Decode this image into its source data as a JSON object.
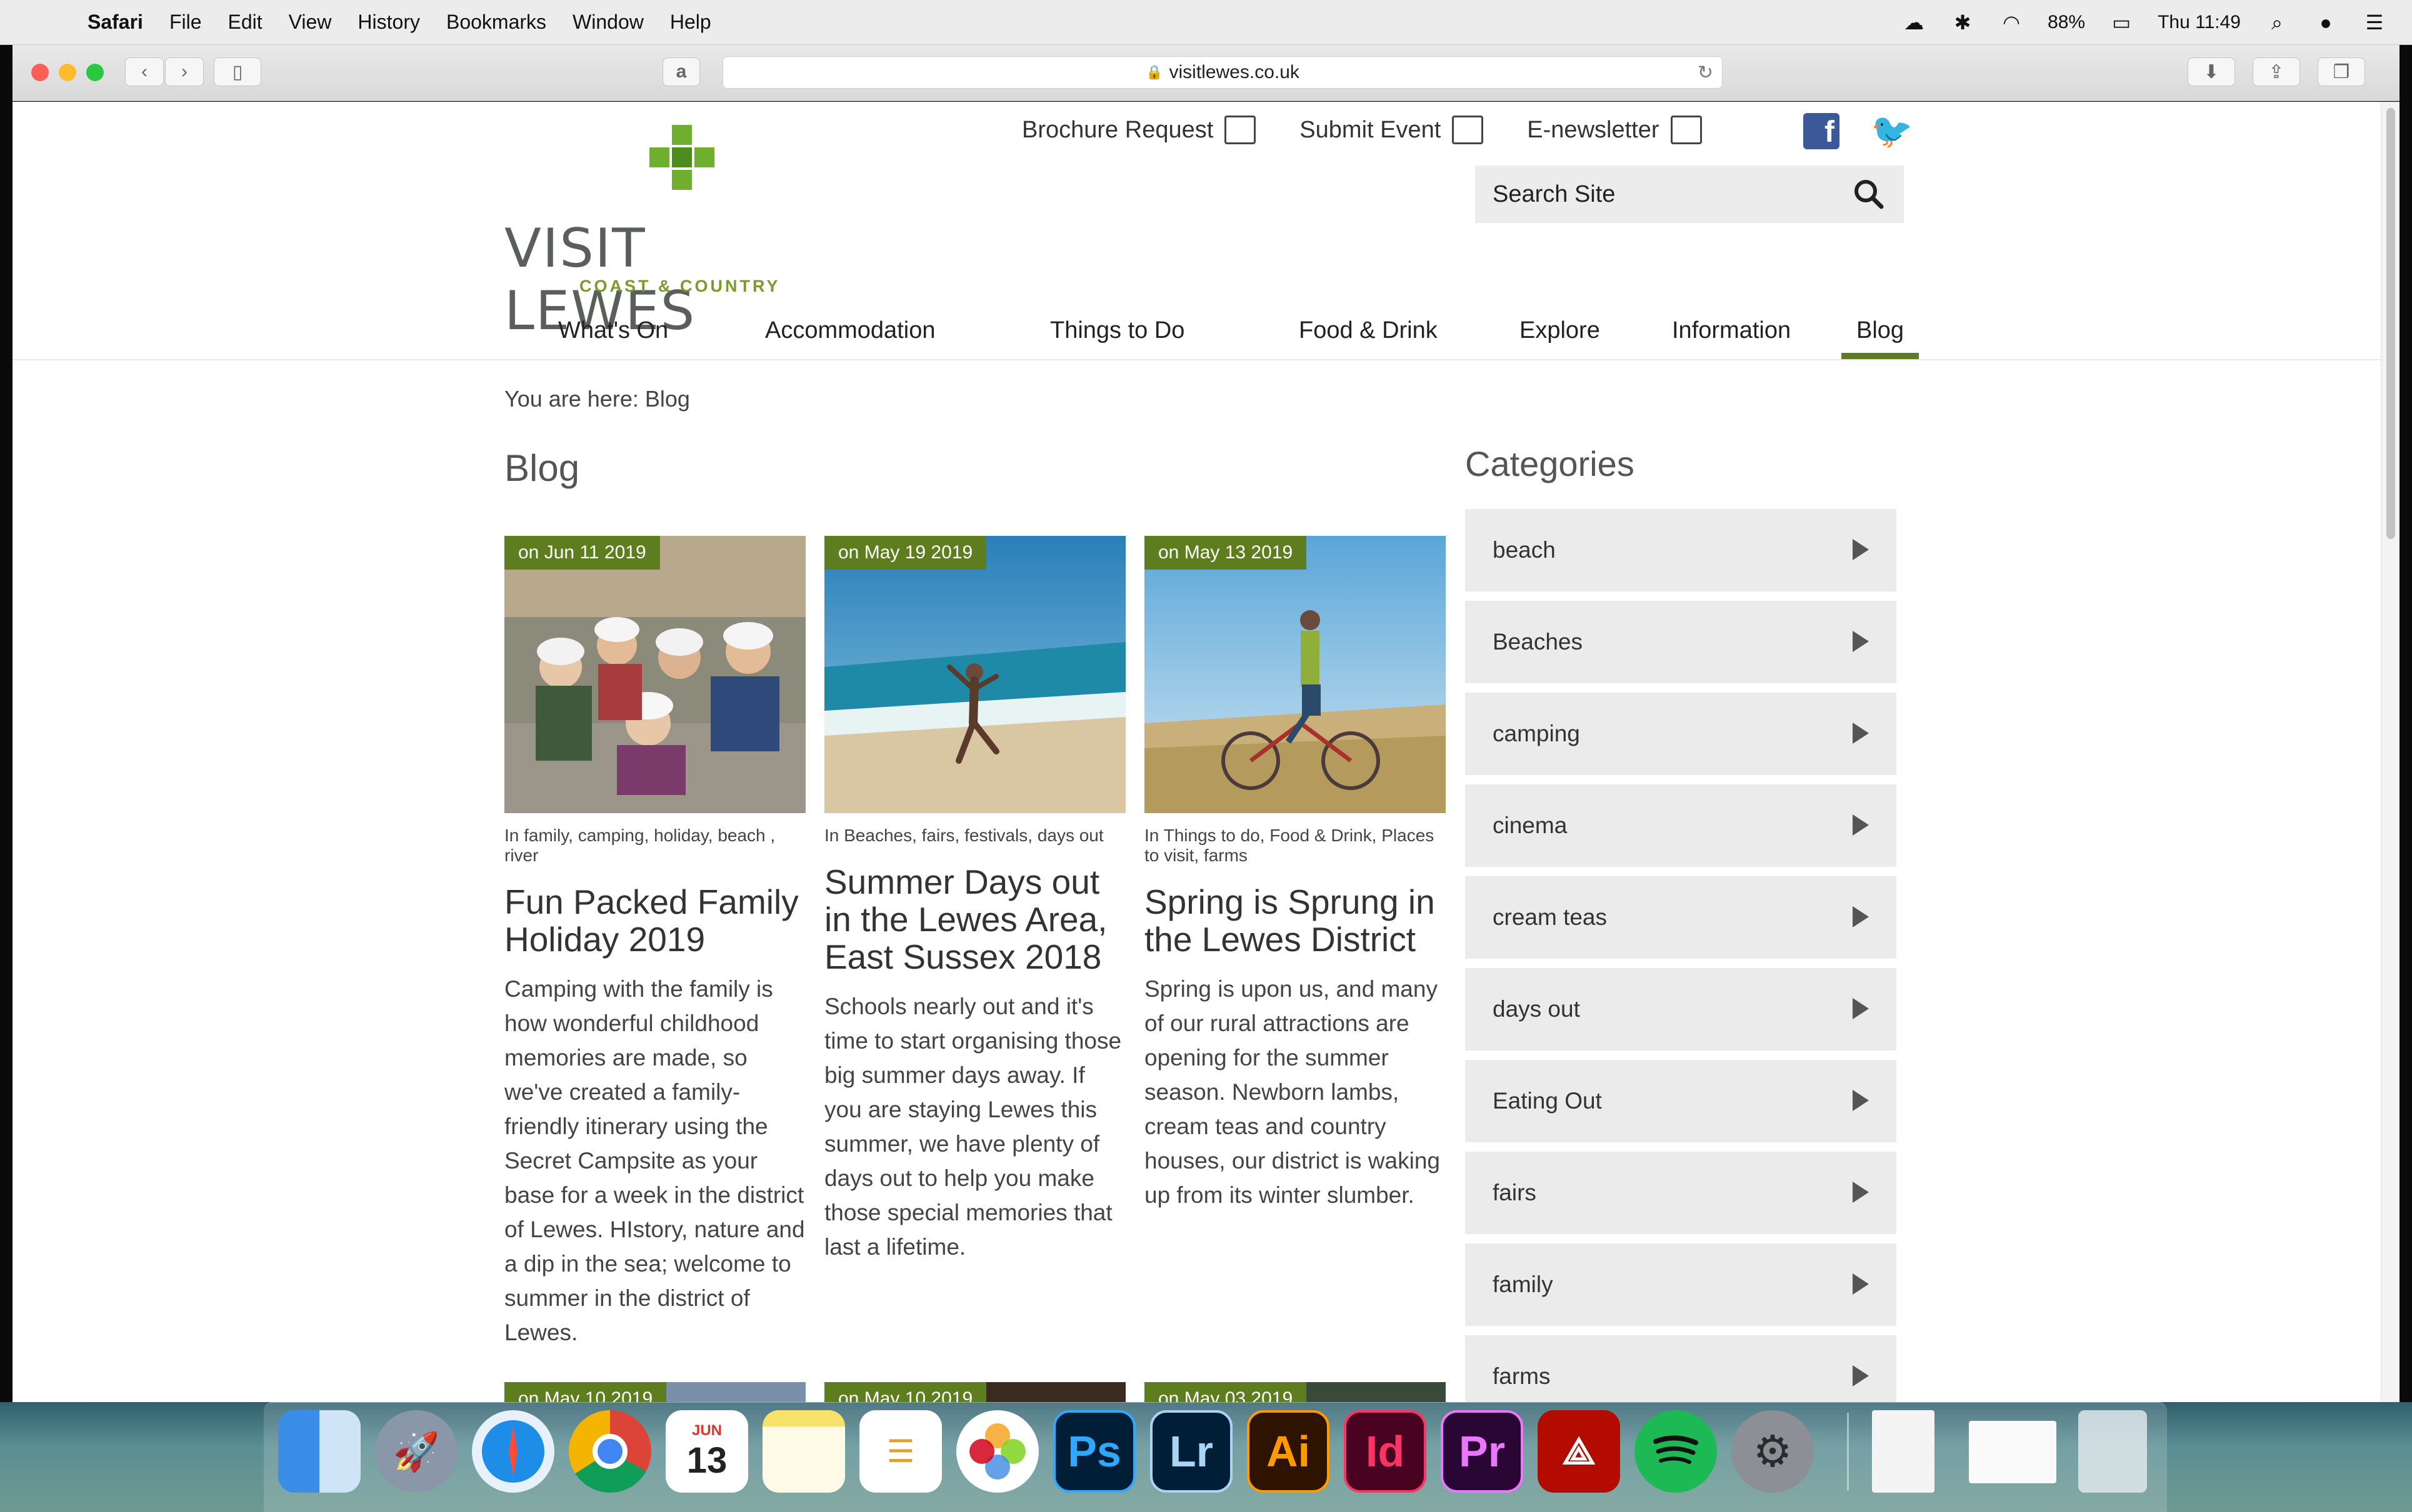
{
  "menubar": {
    "app": "Safari",
    "items": [
      "File",
      "Edit",
      "View",
      "History",
      "Bookmarks",
      "Window",
      "Help"
    ],
    "battery": "88%",
    "clock": "Thu 11:49"
  },
  "browser": {
    "url": "visitlewes.co.uk"
  },
  "site": {
    "logo_title": "VISIT LEWES",
    "logo_sub": "COAST & COUNTRY",
    "toplinks": [
      "Brochure Request",
      "Submit Event",
      "E-newsletter"
    ],
    "search_label": "Search Site",
    "nav": [
      "What's On",
      "Accommodation",
      "Things to Do",
      "Food & Drink",
      "Explore",
      "Information",
      "Blog"
    ],
    "active_nav": "Blog",
    "breadcrumb": "You are here: Blog",
    "page_title": "Blog",
    "categories_title": "Categories",
    "categories": [
      "beach",
      "Beaches",
      "camping",
      "cinema",
      "cream teas",
      "days out",
      "Eating Out",
      "fairs",
      "family",
      "farms"
    ]
  },
  "posts": [
    {
      "date": "on Jun 11 2019",
      "tags": "In  family,  camping,  holiday,  beach ,  river",
      "title": "Fun Packed Family Holiday 2019",
      "excerpt": "Camping with the family is how wonderful childhood memories are made, so we've created a family-friendly itinerary using the Secret Campsite as your base for a week in the district of Lewes. HIstory, nature and a dip in the sea; welcome to summer in the district of Lewes."
    },
    {
      "date": "on May 19 2019",
      "tags": "In  Beaches,  fairs,  festivals,  days out",
      "title": "Summer Days out in the Lewes Area, East Sussex 2018",
      "excerpt": "Schools nearly out and it's time to start organising those big summer days away. If you are staying Lewes this summer, we have plenty of days out to help you make those special memories that last a lifetime."
    },
    {
      "date": "on May 13 2019",
      "tags": "In  Things to do,  Food & Drink,  Places to visit,  farms",
      "title": "Spring is Sprung in the Lewes District",
      "excerpt": "Spring is upon us, and many of our rural attractions are opening for the summer season. Newborn lambs, cream teas and country houses, our district is waking up from its winter slumber."
    }
  ],
  "next_posts": [
    {
      "date": "on May 10 2019"
    },
    {
      "date": "on May 10 2019"
    },
    {
      "date": "on May 03 2019"
    }
  ],
  "dock": {
    "calendar_month": "JUN",
    "calendar_day": "13",
    "ps": "Ps",
    "lr": "Lr",
    "ai": "Ai",
    "id": "Id",
    "pr": "Pr"
  },
  "colors": {
    "brand_green": "#5d7d1e",
    "logo_green": "#6fae2e",
    "text": "#333333"
  }
}
